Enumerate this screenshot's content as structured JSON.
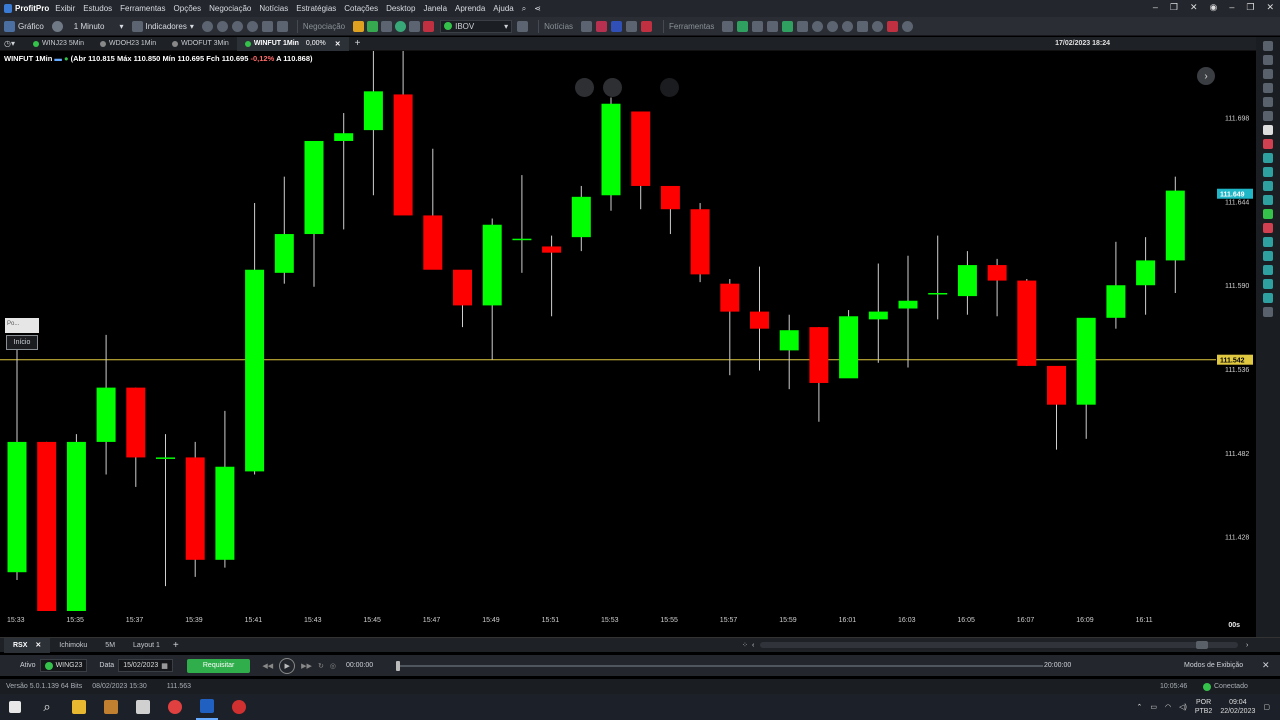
{
  "menubar": {
    "app": "ProfitPro",
    "items": [
      "Exibir",
      "Estudos",
      "Ferramentas",
      "Opções",
      "Negociação",
      "Notícias",
      "Estratégias",
      "Cotações",
      "Desktop",
      "Janela",
      "Aprenda",
      "Ajuda"
    ]
  },
  "toolbar": {
    "chart_label": "Gráfico",
    "interval": "1 Minuto",
    "indicators": "Indicadores",
    "negociacao": "Negociação",
    "asset": "IBOV",
    "noticias": "Notícias",
    "ferramentas": "Ferramentas"
  },
  "tabs": [
    {
      "label": "WINJ23 5Min"
    },
    {
      "label": "WDOH23 1Min"
    },
    {
      "label": "WDOFUT 3Min"
    },
    {
      "label": "WINFUT 1Min",
      "pct": "0,00%"
    }
  ],
  "datetime": "17/02/2023 18:24",
  "quote": {
    "symbol": "WINFUT 1Min",
    "abr": "110.815",
    "max": "110.850",
    "min": "110.695",
    "fch": "110.695",
    "chg": "-0,12%",
    "a": "110.868",
    "abr_label": "(Abr",
    "max_label": "Máx",
    "min_label": "Mín",
    "fch_label": "Fch",
    "a_label": "A"
  },
  "chart_ui": {
    "pos_label": "Po...",
    "start_label": "Início",
    "seconds": "00s",
    "nav_label": "›"
  },
  "chart_data": {
    "type": "candlestick",
    "ylim": [
      111.38,
      111.741
    ],
    "price_ticks": [
      "111.698",
      "111.644",
      "111.590",
      "111.536",
      "111.482",
      "111.428"
    ],
    "price_tick_values": [
      111.698,
      111.644,
      111.59,
      111.536,
      111.482,
      111.428
    ],
    "current_price_label": "111.649",
    "current_price": 111.649,
    "reference_line_label": "111.542",
    "reference_line": 111.542,
    "time_ticks": [
      "15:33",
      "15:35",
      "15:37",
      "15:39",
      "15:41",
      "15:43",
      "15:45",
      "15:47",
      "15:49",
      "15:51",
      "15:53",
      "15:55",
      "15:57",
      "15:59",
      "16:01",
      "16:03",
      "16:05",
      "16:07",
      "16:09",
      "16:11"
    ],
    "colors": {
      "up": "#00ff00",
      "down": "#ff0000",
      "ref": "#e0c940"
    },
    "candles": [
      {
        "t": "15:33",
        "o": 111.405,
        "h": 111.55,
        "l": 111.4,
        "c": 111.489
      },
      {
        "t": "15:34",
        "o": 111.489,
        "h": 111.489,
        "l": 111.38,
        "c": 111.38
      },
      {
        "t": "15:35",
        "o": 111.38,
        "h": 111.494,
        "l": 111.38,
        "c": 111.489
      },
      {
        "t": "15:36",
        "o": 111.489,
        "h": 111.558,
        "l": 111.468,
        "c": 111.524
      },
      {
        "t": "15:37",
        "o": 111.524,
        "h": 111.524,
        "l": 111.46,
        "c": 111.479
      },
      {
        "t": "15:38",
        "o": 111.479,
        "h": 111.494,
        "l": 111.396,
        "c": 111.479
      },
      {
        "t": "15:39",
        "o": 111.479,
        "h": 111.489,
        "l": 111.402,
        "c": 111.413
      },
      {
        "t": "15:40",
        "o": 111.413,
        "h": 111.509,
        "l": 111.408,
        "c": 111.473
      },
      {
        "t": "15:41",
        "o": 111.47,
        "h": 111.643,
        "l": 111.468,
        "c": 111.6
      },
      {
        "t": "15:42",
        "o": 111.598,
        "h": 111.66,
        "l": 111.591,
        "c": 111.623
      },
      {
        "t": "15:43",
        "o": 111.623,
        "h": 111.666,
        "l": 111.589,
        "c": 111.683
      },
      {
        "t": "15:44",
        "o": 111.683,
        "h": 111.701,
        "l": 111.626,
        "c": 111.688
      },
      {
        "t": "15:45",
        "o": 111.69,
        "h": 111.741,
        "l": 111.648,
        "c": 111.715
      },
      {
        "t": "15:46",
        "o": 111.713,
        "h": 111.741,
        "l": 111.636,
        "c": 111.635
      },
      {
        "t": "15:47",
        "o": 111.635,
        "h": 111.678,
        "l": 111.602,
        "c": 111.6
      },
      {
        "t": "15:48",
        "o": 111.6,
        "h": 111.598,
        "l": 111.563,
        "c": 111.577
      },
      {
        "t": "15:49",
        "o": 111.577,
        "h": 111.633,
        "l": 111.542,
        "c": 111.629
      },
      {
        "t": "15:50",
        "o": 111.62,
        "h": 111.661,
        "l": 111.598,
        "c": 111.62
      },
      {
        "t": "15:51",
        "o": 111.615,
        "h": 111.622,
        "l": 111.57,
        "c": 111.611
      },
      {
        "t": "15:52",
        "o": 111.621,
        "h": 111.654,
        "l": 111.612,
        "c": 111.647
      },
      {
        "t": "15:53",
        "o": 111.648,
        "h": 111.711,
        "l": 111.638,
        "c": 111.707
      },
      {
        "t": "15:54",
        "o": 111.702,
        "h": 111.701,
        "l": 111.639,
        "c": 111.654
      },
      {
        "t": "15:55",
        "o": 111.654,
        "h": 111.644,
        "l": 111.623,
        "c": 111.639
      },
      {
        "t": "15:56",
        "o": 111.639,
        "h": 111.643,
        "l": 111.592,
        "c": 111.597
      },
      {
        "t": "15:57",
        "o": 111.591,
        "h": 111.594,
        "l": 111.532,
        "c": 111.573
      },
      {
        "t": "15:58",
        "o": 111.573,
        "h": 111.602,
        "l": 111.535,
        "c": 111.562
      },
      {
        "t": "15:59",
        "o": 111.548,
        "h": 111.571,
        "l": 111.523,
        "c": 111.561
      },
      {
        "t": "16:00",
        "o": 111.563,
        "h": 111.563,
        "l": 111.502,
        "c": 111.527
      },
      {
        "t": "16:01",
        "o": 111.53,
        "h": 111.574,
        "l": 111.531,
        "c": 111.57
      },
      {
        "t": "16:02",
        "o": 111.568,
        "h": 111.604,
        "l": 111.54,
        "c": 111.573
      },
      {
        "t": "16:03",
        "o": 111.575,
        "h": 111.609,
        "l": 111.537,
        "c": 111.58
      },
      {
        "t": "16:04",
        "o": 111.585,
        "h": 111.622,
        "l": 111.568,
        "c": 111.585
      },
      {
        "t": "16:05",
        "o": 111.583,
        "h": 111.612,
        "l": 111.571,
        "c": 111.603
      },
      {
        "t": "16:06",
        "o": 111.603,
        "h": 111.607,
        "l": 111.57,
        "c": 111.593
      },
      {
        "t": "16:07",
        "o": 111.593,
        "h": 111.594,
        "l": 111.538,
        "c": 111.538
      },
      {
        "t": "16:08",
        "o": 111.538,
        "h": 111.529,
        "l": 111.484,
        "c": 111.513
      },
      {
        "t": "16:09",
        "o": 111.513,
        "h": 111.56,
        "l": 111.491,
        "c": 111.569
      },
      {
        "t": "16:10",
        "o": 111.569,
        "h": 111.618,
        "l": 111.562,
        "c": 111.59
      },
      {
        "t": "16:11",
        "o": 111.59,
        "h": 111.621,
        "l": 111.571,
        "c": 111.606
      },
      {
        "t": "16:12",
        "o": 111.606,
        "h": 111.66,
        "l": 111.585,
        "c": 111.651
      }
    ]
  },
  "bottom_tabs": [
    "RSX",
    "Ichimoku",
    "5M",
    "Layout 1"
  ],
  "replay": {
    "ativo_label": "Ativo",
    "ativo": "WING23",
    "data_label": "Data",
    "data": "15/02/2023",
    "requisitar": "Requisitar",
    "start_time": "00:00:00",
    "end_time": "20:00:00",
    "modos": "Modos de Exibição"
  },
  "status": {
    "versao": "Versão 5.0.1.139 64 Bits",
    "build": "08/02/2023 15:30",
    "price": "111.563",
    "clock": "10:05:46",
    "conn": "Conectado"
  },
  "taskbar": {
    "lang1": "POR",
    "lang2": "PTB2",
    "time": "09:04",
    "date": "22/02/2023"
  }
}
